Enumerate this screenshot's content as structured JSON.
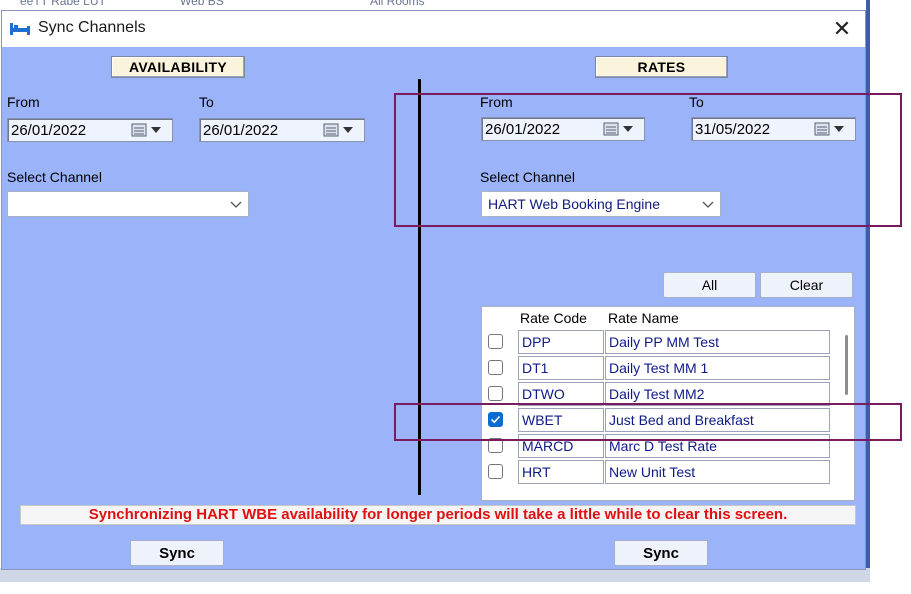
{
  "window": {
    "title": "Sync Channels",
    "close_label": "✕"
  },
  "background": {
    "ghost_text": [
      "eeTT Rabe LUT",
      "Web BS",
      "All Rooms"
    ]
  },
  "availability": {
    "header": "AVAILABILITY",
    "from_label": "From",
    "to_label": "To",
    "from_date": "26/01/2022",
    "to_date": "26/01/2022",
    "channel_label": "Select Channel",
    "channel_value": ""
  },
  "rates": {
    "header": "RATES",
    "from_label": "From",
    "to_label": "To",
    "from_date": "26/01/2022",
    "to_date": "31/05/2022",
    "channel_label": "Select Channel",
    "channel_value": "HART Web Booking Engine",
    "all_label": "All",
    "clear_label": "Clear",
    "columns": [
      "Rate  Code",
      "Rate Name"
    ],
    "rows": [
      {
        "code": "DPP",
        "name": "Daily PP MM Test",
        "checked": false
      },
      {
        "code": "DT1",
        "name": "Daily Test MM 1",
        "checked": false
      },
      {
        "code": "DTWO",
        "name": "Daily Test MM2",
        "checked": false
      },
      {
        "code": "WBET",
        "name": "Just Bed and Breakfast",
        "checked": true
      },
      {
        "code": "MARCD",
        "name": "Marc D Test Rate",
        "checked": false
      },
      {
        "code": "HRT",
        "name": "New Unit Test",
        "checked": false
      }
    ]
  },
  "footer": {
    "warning": "Synchronizing HART WBE availability for longer periods will take a little while to clear this screen.",
    "sync_left_label": "Sync",
    "sync_right_label": "Sync"
  },
  "colors": {
    "window_bg": "#9bb3f8",
    "warning_text": "#e01010",
    "highlight_border": "#7a1b5f",
    "checkbox_checked": "#0a6cd1"
  }
}
